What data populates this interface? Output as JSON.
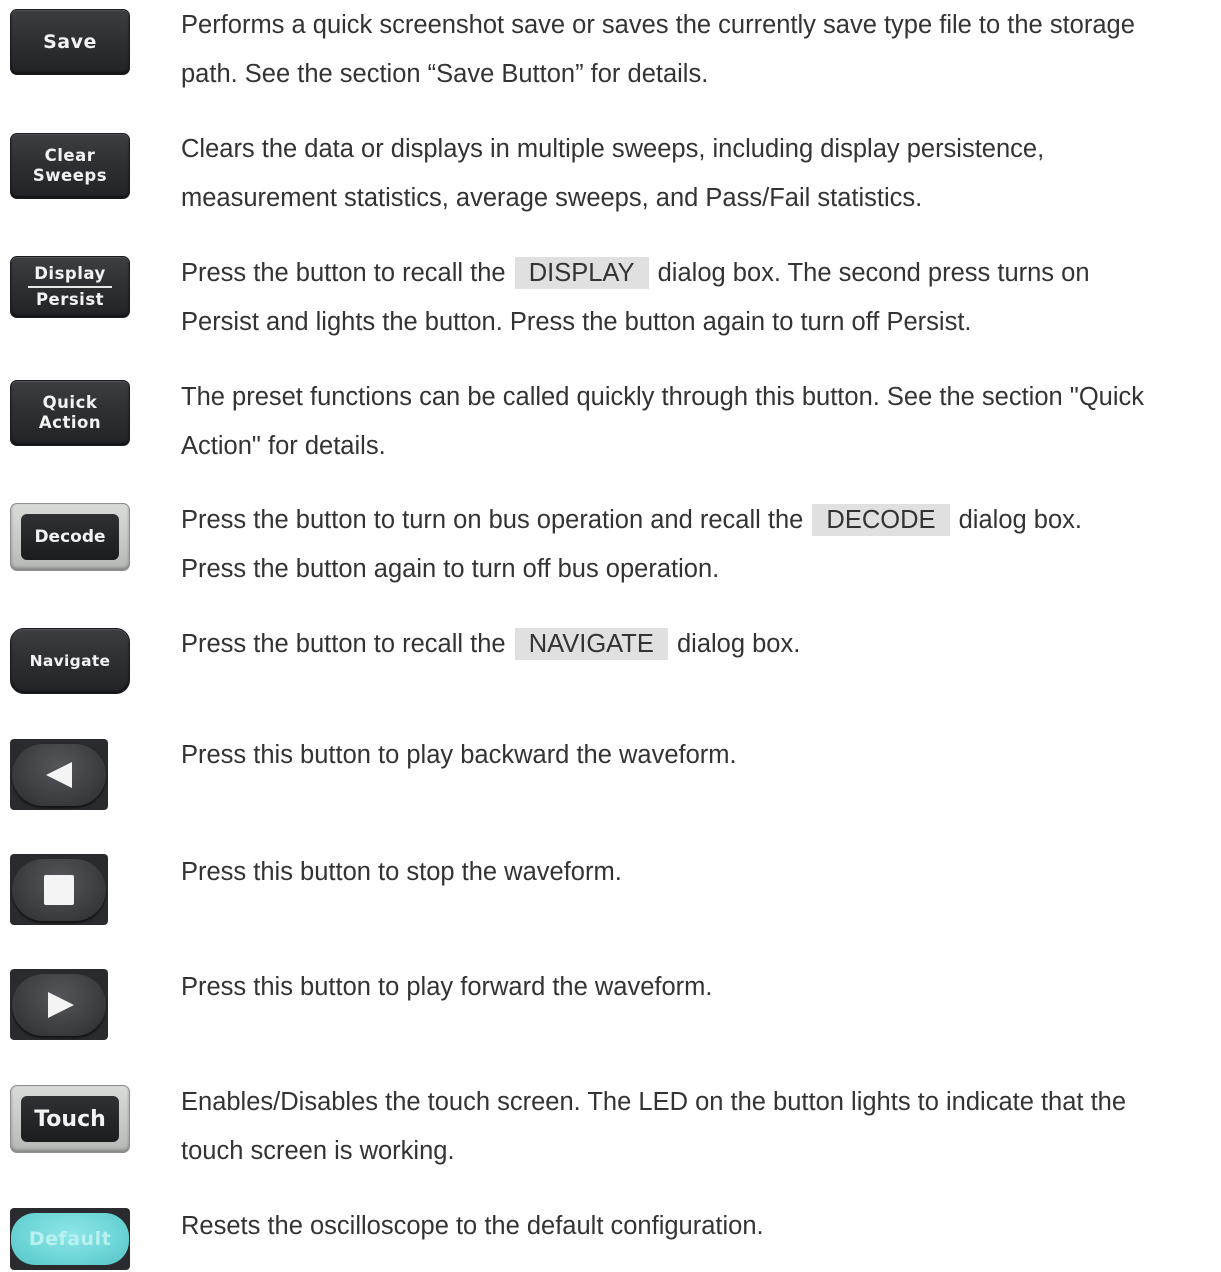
{
  "rows": [
    {
      "button_label": "Save",
      "lines": [
        "Performs a quick screenshot save or saves the currently save type file to the storage",
        "path. See the section “Save Button” for details."
      ]
    },
    {
      "button_label_top": "Clear",
      "button_label_bottom": "Sweeps",
      "lines": [
        "Clears the data or displays in multiple sweeps, including display persistence,",
        "measurement statistics, average sweeps, and Pass/Fail statistics."
      ]
    },
    {
      "button_label_top": "Display",
      "button_label_bottom": "Persist",
      "line1_before": "Press the button to recall the",
      "line1_key": "DISPLAY",
      "line1_after": "dialog box. The second press turns on",
      "line2": "Persist and lights the button. Press the button again to turn off Persist."
    },
    {
      "button_label_top": "Quick",
      "button_label_bottom": "Action",
      "lines": [
        "The preset functions can be called quickly through this button. See the section \"Quick",
        "Action\" for details."
      ]
    },
    {
      "button_label": "Decode",
      "line1_before": "Press the button to turn on bus operation and recall the",
      "line1_key": "DECODE",
      "line1_after": "dialog box.",
      "line2": "Press the button again to turn off bus operation."
    },
    {
      "button_label": "Navigate",
      "line1_before": "Press the button to recall the",
      "line1_key": "NAVIGATE",
      "line1_after": "dialog box."
    },
    {
      "button_icon": "play-backward-icon",
      "lines": [
        "Press this button to play backward the waveform."
      ]
    },
    {
      "button_icon": "stop-icon",
      "lines": [
        "Press this button to stop the waveform."
      ]
    },
    {
      "button_icon": "play-forward-icon",
      "lines": [
        "Press this button to play forward the waveform."
      ]
    },
    {
      "button_label": "Touch",
      "lines": [
        "Enables/Disables the touch screen. The LED on the button lights to indicate that the",
        "touch screen is working."
      ]
    },
    {
      "button_label": "Default",
      "lines": [
        "Resets the oscilloscope to the default configuration."
      ]
    }
  ]
}
